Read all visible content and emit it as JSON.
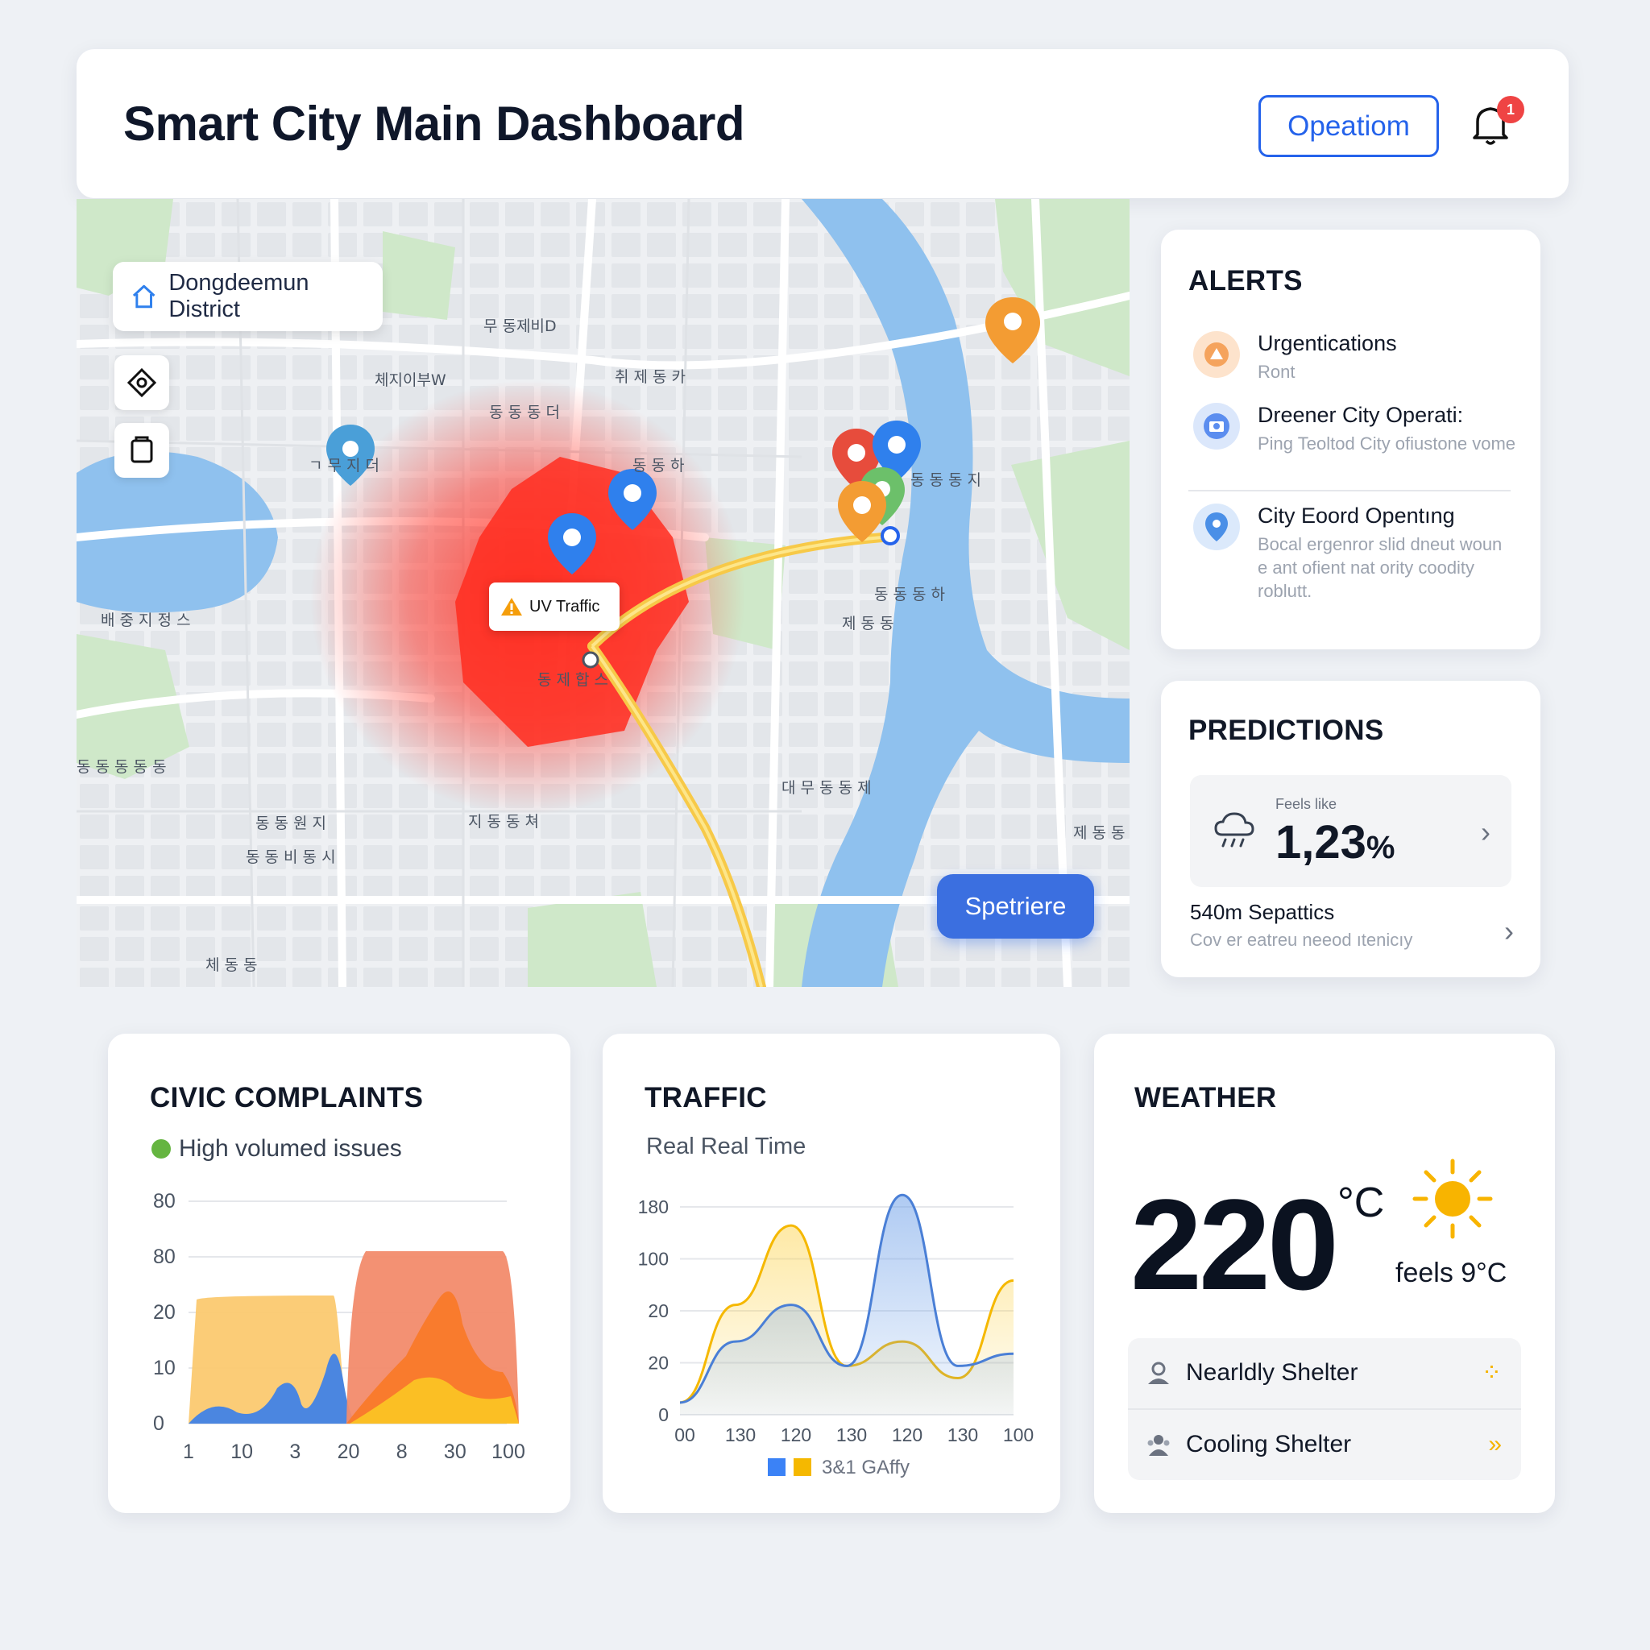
{
  "header": {
    "title": "Smart City Main Dashboard",
    "operation_button": "Opeatiom",
    "notification_count": "1"
  },
  "map": {
    "district": "Dongdeemun District",
    "traffic_callout": "UV Traffic",
    "action_button": "Spetriere",
    "labels": [
      "무 동제비D",
      "체지이부W",
      "취 제 동 카",
      "동 동 동 더",
      "ㄱ 무 지 더",
      "동 동 하",
      "동 동 동 지",
      "동 동 동 하",
      "제 동 동",
      "배 중 지 정 스",
      "동 제 합 스",
      "동 동 동 동 동",
      "대 무 동 동 제",
      "동 동 원 지",
      "지 동 동 쳐",
      "동 동 비 동 시",
      "제 동 동 수",
      "체 동 동"
    ],
    "colors": {
      "water": "#8fc1ee",
      "park": "#cfe8c9",
      "heat": "#ff3b30",
      "route": "#f7c948"
    }
  },
  "alerts": {
    "title": "ALERTS",
    "items": [
      {
        "title": "Urgentications",
        "subtitle": "Ront",
        "icon": "alarm-icon",
        "color": "#f5a35c"
      },
      {
        "title": "Dreener City Operati:",
        "subtitle": "Ping Teoltod City ofiustone vome",
        "icon": "camera-icon",
        "color": "#5b8def"
      },
      {
        "title": "City Eoord Opentıng",
        "subtitle": "Bocal ergenror slid dneut woun e ant ofient nat ority coodity roblutt.",
        "icon": "location-pin-icon",
        "color": "#4a8fe7"
      }
    ]
  },
  "predictions": {
    "title": "PREDICTIONS",
    "feels_label": "Feels like",
    "value": "1,23",
    "value_unit": "%",
    "row_title": "540m Sepattics",
    "row_subtitle": "Cov er eatreu neeod ıtenicıy"
  },
  "civic": {
    "title": "CIVIC COMPLAINTS",
    "legend": "High volumed issues",
    "chart_data": {
      "type": "area",
      "y_ticks": [
        "80",
        "80",
        "20",
        "10",
        "0"
      ],
      "x_ticks": [
        "1",
        "10",
        "3",
        "20",
        "8",
        "30",
        "100"
      ],
      "series": [
        {
          "name": "",
          "color": "#fbbf5b",
          "values": [
            62,
            62,
            62,
            62,
            62,
            5,
            0
          ]
        },
        {
          "name": "",
          "color": "#3b82f6",
          "values": [
            5,
            10,
            30,
            45,
            5,
            0,
            0
          ]
        },
        {
          "name": "",
          "color": "#ef4444",
          "values": [
            0,
            0,
            0,
            0,
            70,
            70,
            70
          ]
        }
      ]
    }
  },
  "traffic": {
    "title": "TRAFFIC",
    "subtitle": "Real Real Time",
    "legend": "3&1 GAffy",
    "chart_data": {
      "type": "line",
      "y_ticks": [
        "180",
        "100",
        "20",
        "20",
        "0"
      ],
      "x_ticks": [
        "00",
        "130",
        "120",
        "130",
        "120",
        "130",
        "100"
      ],
      "series": [
        {
          "name": "",
          "color": "#f5b800",
          "values": [
            10,
            90,
            155,
            40,
            60,
            30,
            110
          ]
        },
        {
          "name": "",
          "color": "#4a7fd6",
          "values": [
            10,
            60,
            90,
            40,
            180,
            40,
            50
          ]
        }
      ]
    }
  },
  "weather": {
    "title": "WEATHER",
    "temperature": "220",
    "unit": "°C",
    "feels": "feels 9°C",
    "shelters": [
      {
        "label": "Nearldly Shelter",
        "icon": "user-icon"
      },
      {
        "label": "Cooling Shelter",
        "icon": "people-icon"
      }
    ]
  }
}
